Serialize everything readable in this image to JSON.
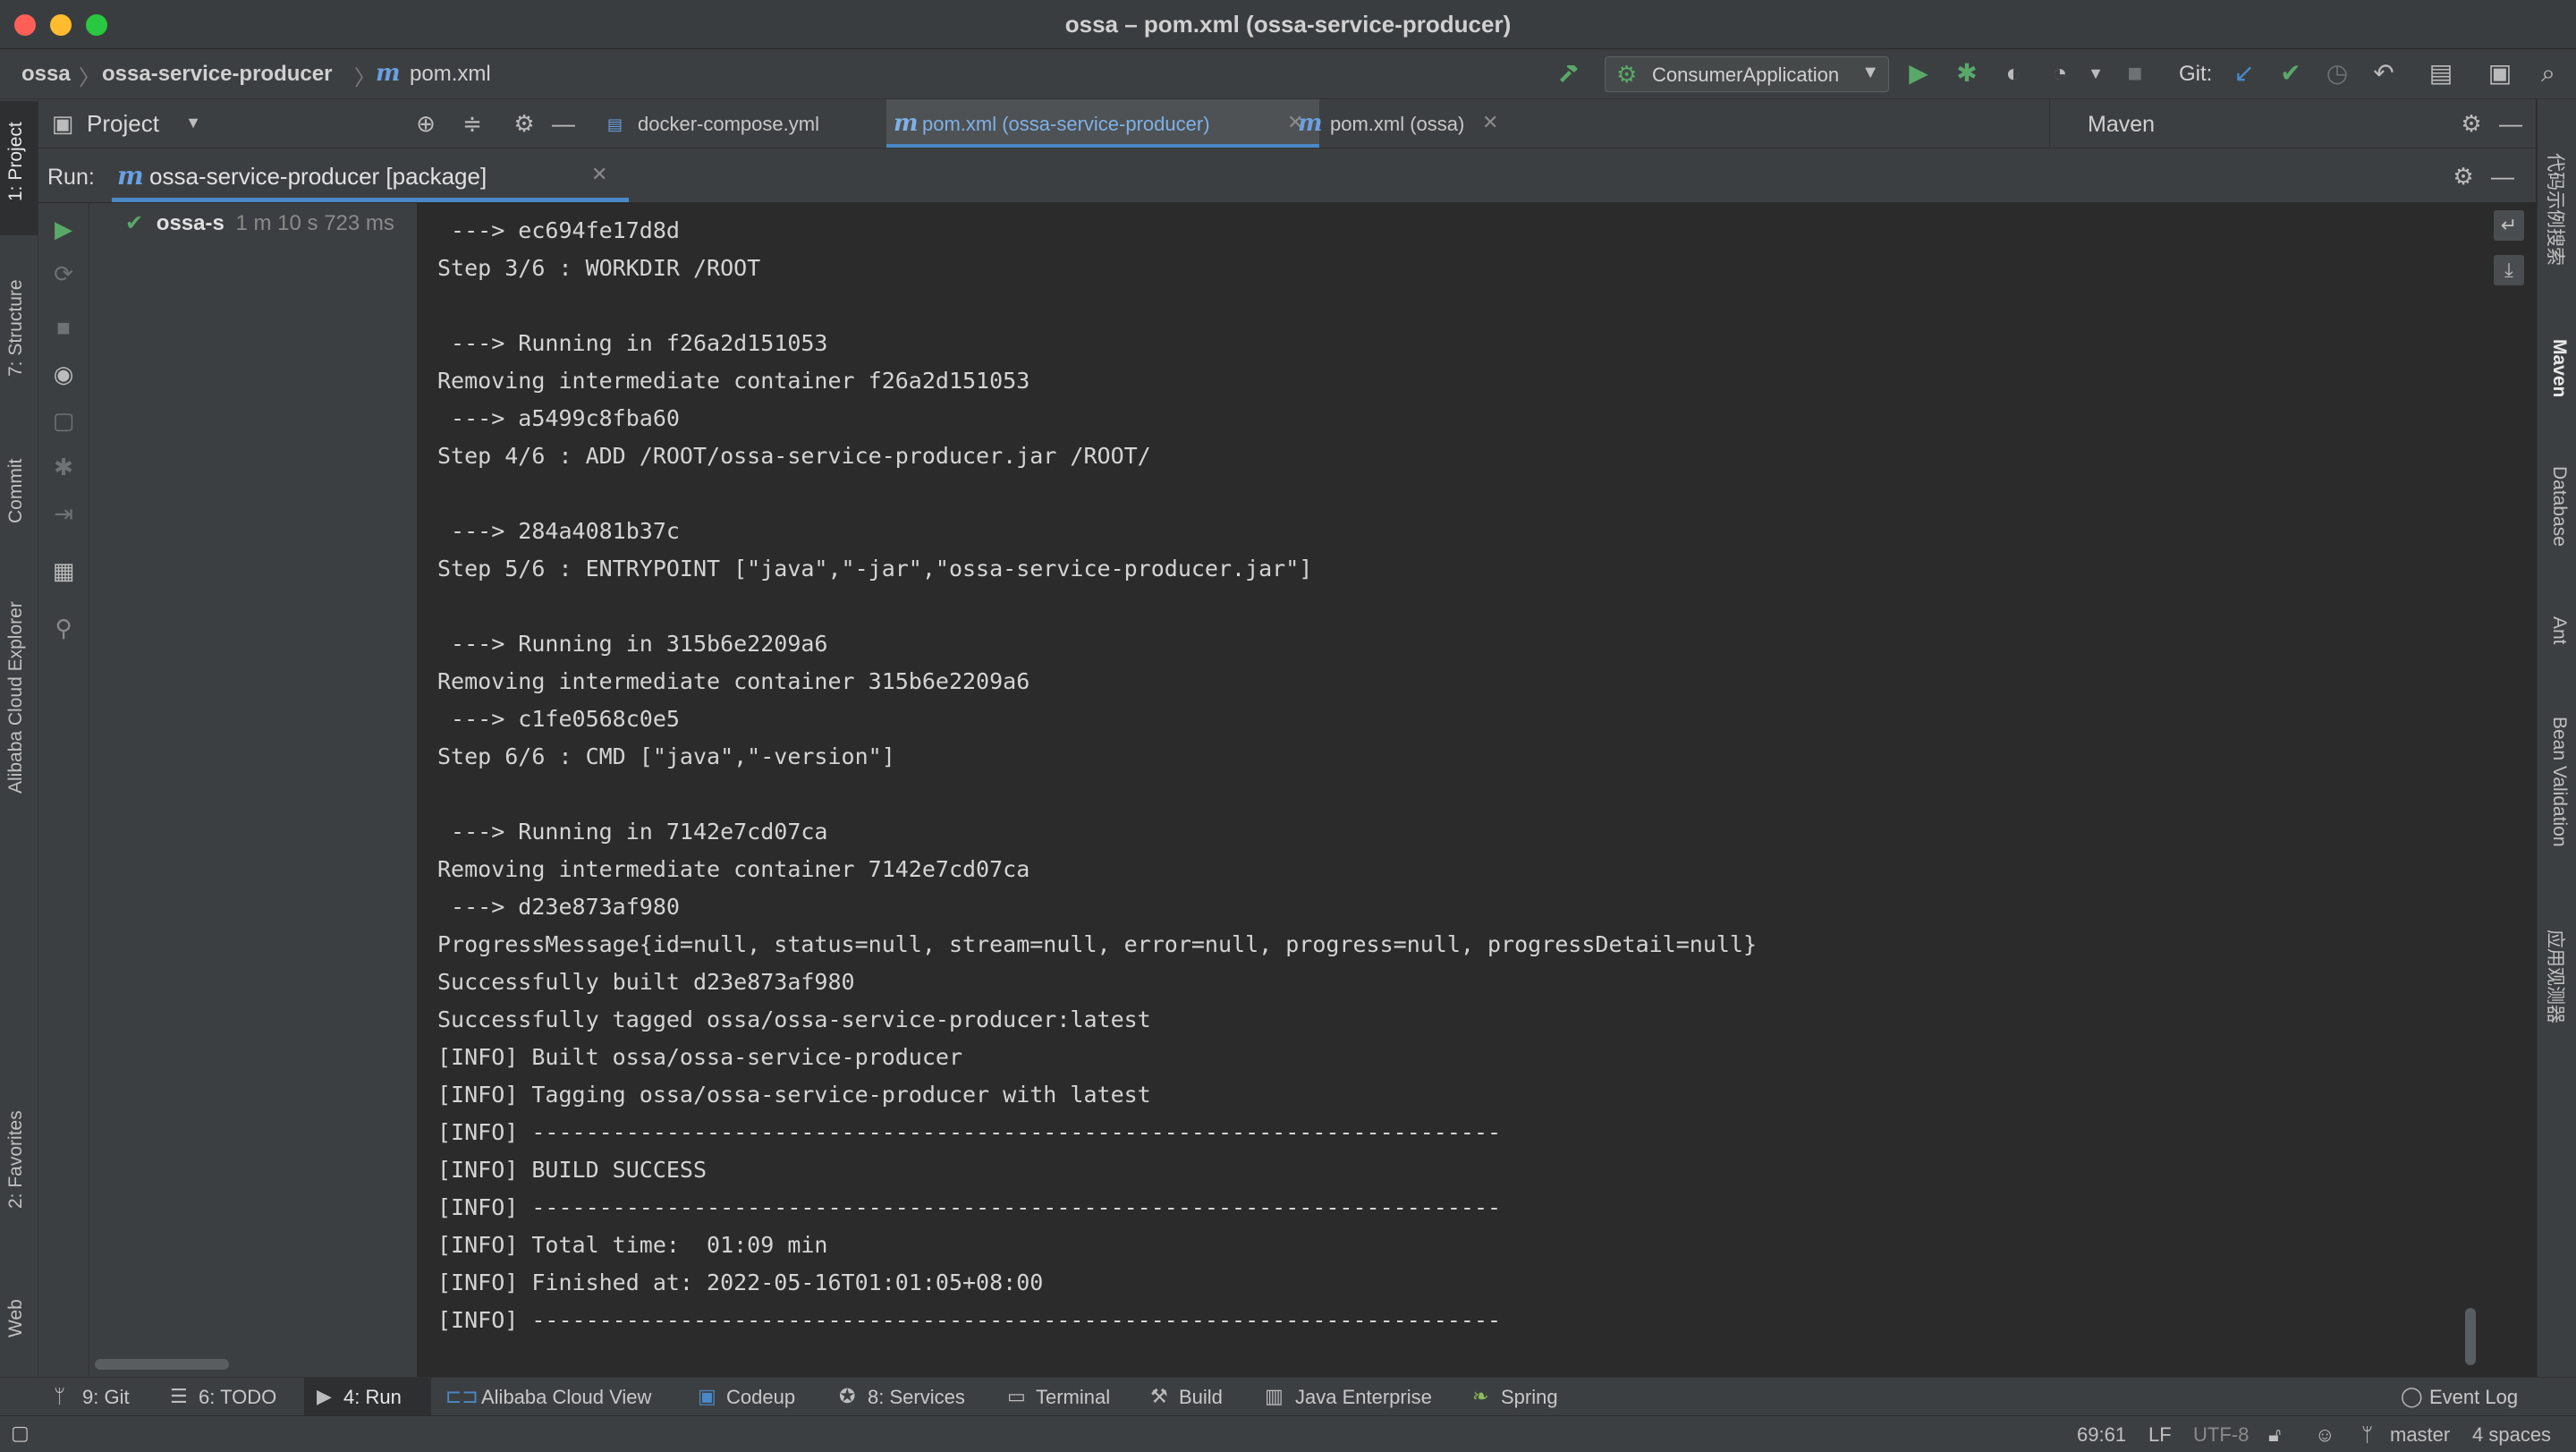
{
  "window": {
    "title": "ossa – pom.xml (ossa-service-producer)"
  },
  "breadcrumb": {
    "root": "ossa",
    "module": "ossa-service-producer",
    "file": "pom.xml",
    "m_glyph": "m"
  },
  "toolbar": {
    "run_config": "ConsumerApplication",
    "git_label": "Git:"
  },
  "left_stripe": {
    "tabs": [
      {
        "number": "1",
        "label": "1: Project"
      },
      {
        "label": "7: Structure"
      },
      {
        "label": "Commit"
      },
      {
        "label": "Alibaba Cloud Explorer"
      },
      {
        "label": "2: Favorites"
      },
      {
        "label": "Web"
      }
    ]
  },
  "right_stripe": {
    "tabs": [
      {
        "label": "代码示例搜索"
      },
      {
        "label": "Maven"
      },
      {
        "label": "Database"
      },
      {
        "label": "Ant"
      },
      {
        "label": "Bean Validation"
      },
      {
        "label": "应用观测器"
      }
    ]
  },
  "project_panel": {
    "title": "Project"
  },
  "editor_tabs": [
    {
      "label": "docker-compose.yml"
    },
    {
      "label": "pom.xml (ossa-service-producer)"
    },
    {
      "label": "pom.xml (ossa)"
    }
  ],
  "maven_panel": {
    "title": "Maven"
  },
  "run_panel": {
    "label": "Run:",
    "tab_label": "ossa-service-producer [package]",
    "tree_item": {
      "name": "ossa-s",
      "time": "1 m 10 s 723 ms"
    }
  },
  "console_lines": [
    " ---> ec694fe17d8d",
    "Step 3/6 : WORKDIR /ROOT",
    "",
    " ---> Running in f26a2d151053",
    "Removing intermediate container f26a2d151053",
    " ---> a5499c8fba60",
    "Step 4/6 : ADD /ROOT/ossa-service-producer.jar /ROOT/",
    "",
    " ---> 284a4081b37c",
    "Step 5/6 : ENTRYPOINT [\"java\",\"-jar\",\"ossa-service-producer.jar\"]",
    "",
    " ---> Running in 315b6e2209a6",
    "Removing intermediate container 315b6e2209a6",
    " ---> c1fe0568c0e5",
    "Step 6/6 : CMD [\"java\",\"-version\"]",
    "",
    " ---> Running in 7142e7cd07ca",
    "Removing intermediate container 7142e7cd07ca",
    " ---> d23e873af980",
    "ProgressMessage{id=null, status=null, stream=null, error=null, progress=null, progressDetail=null}",
    "Successfully built d23e873af980",
    "Successfully tagged ossa/ossa-service-producer:latest",
    "[INFO] Built ossa/ossa-service-producer",
    "[INFO] Tagging ossa/ossa-service-producer with latest",
    "[INFO] ------------------------------------------------------------------------",
    "[INFO] BUILD SUCCESS",
    "[INFO] ------------------------------------------------------------------------",
    "[INFO] Total time:  01:09 min",
    "[INFO] Finished at: 2022-05-16T01:01:05+08:00",
    "[INFO] ------------------------------------------------------------------------"
  ],
  "bottom_tabs": [
    {
      "label": "9: Git",
      "icon": "git-branch-icon"
    },
    {
      "label": "6: TODO",
      "icon": "list-icon"
    },
    {
      "label": "4: Run",
      "icon": "play-icon"
    },
    {
      "label": "Alibaba Cloud View",
      "icon": "alibaba-cloud-icon"
    },
    {
      "label": "Codeup",
      "icon": "codeup-icon"
    },
    {
      "label": "8: Services",
      "icon": "services-icon"
    },
    {
      "label": "Terminal",
      "icon": "terminal-icon"
    },
    {
      "label": "Build",
      "icon": "hammer-icon"
    },
    {
      "label": "Java Enterprise",
      "icon": "java-enterprise-icon"
    },
    {
      "label": "Spring",
      "icon": "spring-leaf-icon"
    }
  ],
  "status": {
    "event_log": "Event Log",
    "position": "69:61",
    "line_sep": "LF",
    "encoding": "UTF-8",
    "branch": "master",
    "indent": "4 spaces"
  },
  "colors": {
    "accent_blue": "#4a88c7",
    "run_green": "#59a869",
    "background": "#2b2b2b",
    "panel": "#3c3f41"
  }
}
